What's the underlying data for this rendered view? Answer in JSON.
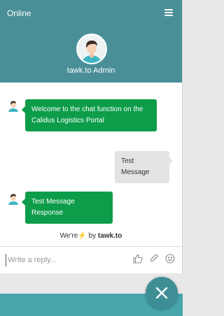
{
  "header": {
    "status": "Online",
    "agent_name": "tawk.to Admin"
  },
  "messages": [
    {
      "from": "agent",
      "text": "Welcome to the chat function on the Calidus Logistics Portal"
    },
    {
      "from": "visitor",
      "text": "Test Message"
    },
    {
      "from": "agent",
      "text": "Test Message Response"
    }
  ],
  "footer": {
    "powered_prefix": "We're",
    "powered_bolt": "⚡",
    "powered_by": "by",
    "powered_brand": "tawk.to"
  },
  "composer": {
    "placeholder": "Write a reply...",
    "icons": [
      "thumbs-up-icon",
      "paperclip-icon",
      "emoji-icon"
    ]
  },
  "colors": {
    "header": "#4a8f97",
    "agent_bubble": "#0d9d4a",
    "visitor_bubble": "#e4e4e4",
    "fab": "#3e8e95",
    "bottom_bar": "#49a6ad"
  }
}
